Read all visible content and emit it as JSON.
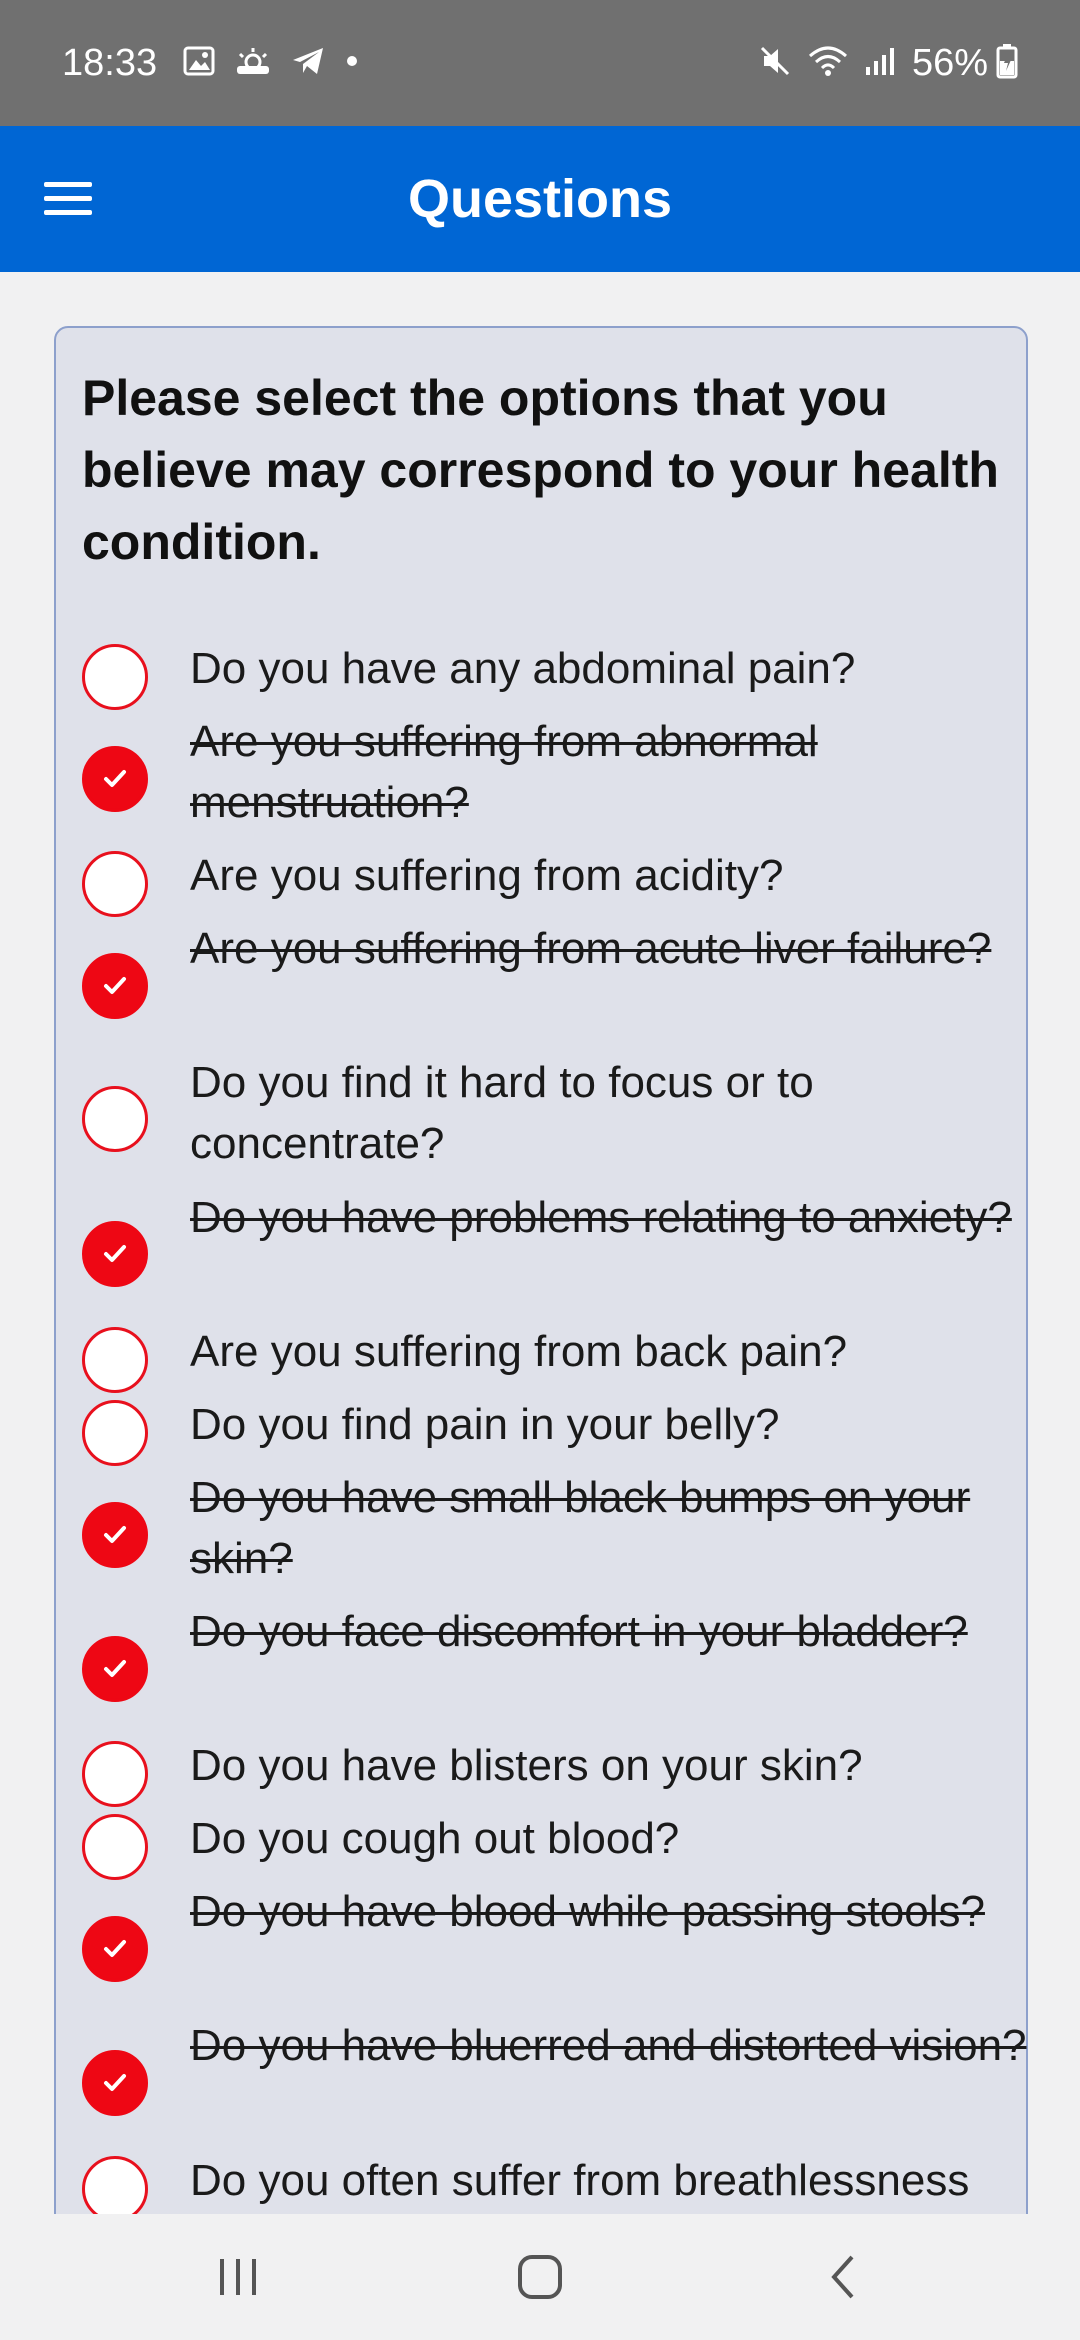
{
  "status_bar": {
    "time": "18:33",
    "battery": "56%",
    "left_icons": [
      "gallery-icon",
      "weather-icon",
      "telegram-icon",
      "dot-icon"
    ],
    "right_icons": [
      "mute-icon",
      "wifi-icon",
      "signal-icon",
      "battery-icon"
    ]
  },
  "app_bar": {
    "title": "Questions",
    "menu_icon": "hamburger-menu-icon",
    "color": "#0066d4"
  },
  "prompt": "Please select the options that you believe may correspond to your health condition.",
  "accent_color": "#ee0714",
  "questions": [
    {
      "text": "Do you have any abdominal pain?",
      "checked": false
    },
    {
      "text": "Are you suffering from abnormal menstruation?",
      "checked": true
    },
    {
      "text": "Are you suffering from acidity?",
      "checked": false
    },
    {
      "text": "Are you suffering from acute liver failure?",
      "checked": true
    },
    {
      "text": "Do you find it hard to focus or to concentrate?",
      "checked": false
    },
    {
      "text": "Do you have problems relating to anxiety?",
      "checked": true
    },
    {
      "text": "Are you suffering from back pain?",
      "checked": false
    },
    {
      "text": "Do you find pain in your belly?",
      "checked": false
    },
    {
      "text": "Do you have small black bumps on your skin?",
      "checked": true
    },
    {
      "text": "Do you face discomfort in your bladder?",
      "checked": true
    },
    {
      "text": "Do you have blisters on your skin?",
      "checked": false
    },
    {
      "text": "Do you cough out blood?",
      "checked": false
    },
    {
      "text": "Do you have blood while passing stools?",
      "checked": true
    },
    {
      "text": "Do you have bluerred and distorted vision?",
      "checked": true
    },
    {
      "text": "Do you often suffer from breathlessness",
      "checked": false
    }
  ],
  "nav_bar": {
    "recents_icon": "recents-icon",
    "home_icon": "home-icon",
    "back_icon": "back-icon"
  }
}
